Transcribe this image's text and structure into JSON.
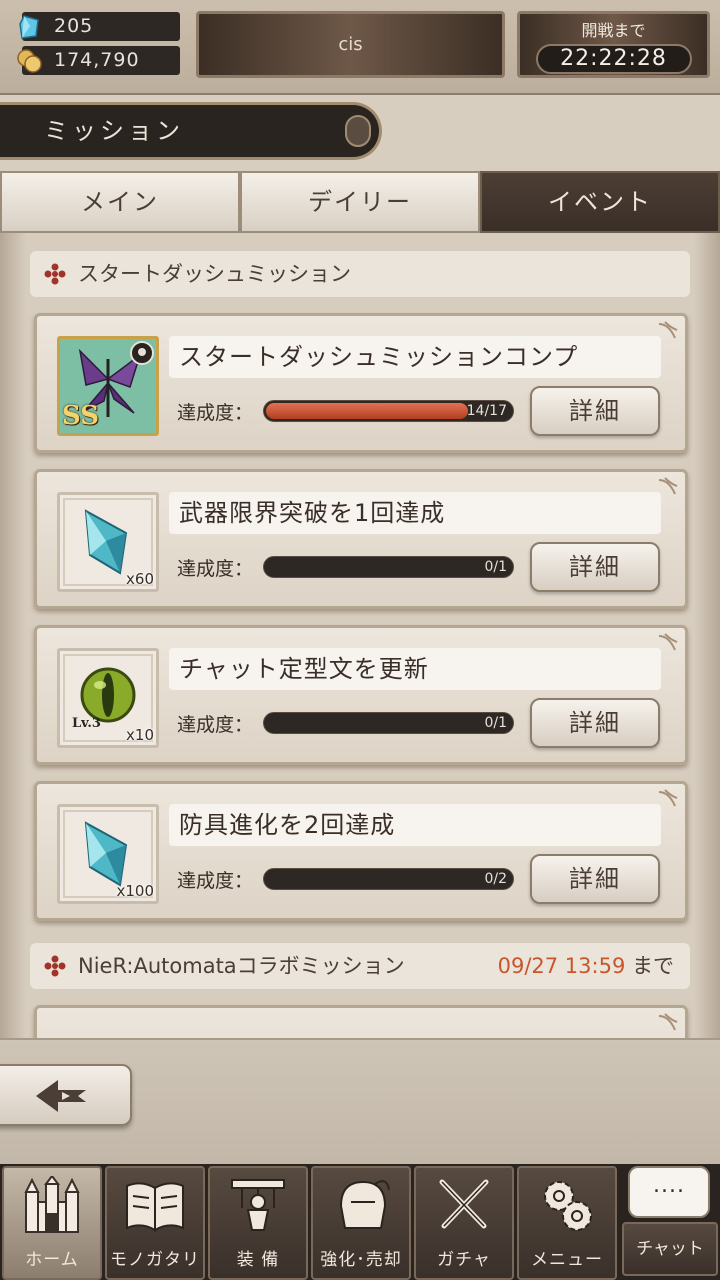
{
  "header": {
    "gems": "205",
    "gold": "174,790",
    "player_name": "cis",
    "timer_label": "開戦まで",
    "timer_value": "22:22:28"
  },
  "page_title": "ミッション",
  "tabs": [
    {
      "label": "メイン",
      "active": false
    },
    {
      "label": "デイリー",
      "active": false
    },
    {
      "label": "イベント",
      "active": true
    }
  ],
  "sections": [
    {
      "title": "スタートダッシュミッション"
    },
    {
      "title": "NieR:Automataコラボミッション",
      "deadline": "09/27 13:59",
      "deadline_suffix": "まで"
    }
  ],
  "progress_label": "達成度：",
  "detail_label": "詳細",
  "missions": [
    {
      "title": "スタートダッシュミッションコンプ",
      "progress": "14/17",
      "fraction": 0.8235,
      "reward": "weapon-butterfly-ss",
      "reward_badge": "SS",
      "reward_qty": ""
    },
    {
      "title": "武器限界突破を1回達成",
      "progress": "0/1",
      "fraction": 0,
      "reward": "crystal",
      "reward_badge": "",
      "reward_qty": "x60"
    },
    {
      "title": "チャット定型文を更新",
      "progress": "0/1",
      "fraction": 0,
      "reward": "green-orb",
      "reward_badge": "Lv.3",
      "reward_qty": "x10"
    },
    {
      "title": "防具進化を2回達成",
      "progress": "0/2",
      "fraction": 0,
      "reward": "crystal",
      "reward_badge": "",
      "reward_qty": "x100"
    }
  ],
  "bottom_nav": [
    {
      "label": "ホーム",
      "icon": "castle-icon",
      "active": true
    },
    {
      "label": "モノガタリ",
      "icon": "book-icon",
      "active": false
    },
    {
      "label": "装 備",
      "icon": "puppet-icon",
      "active": false
    },
    {
      "label": "強化･売却",
      "icon": "helmet-icon",
      "active": false
    },
    {
      "label": "ガチャ",
      "icon": "crossed-swords-icon",
      "active": false
    },
    {
      "label": "メニュー",
      "icon": "gears-icon",
      "active": false
    }
  ],
  "chat": {
    "bubble": "....",
    "label": "チャット"
  },
  "colors": {
    "accent_red": "#c8562a",
    "dark_brown": "#2a2420",
    "parchment": "#ede6dc"
  }
}
